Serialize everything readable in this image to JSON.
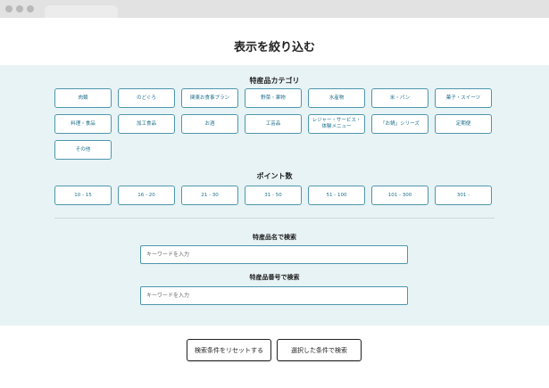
{
  "page": {
    "title": "表示を絞り込む"
  },
  "category_section": {
    "heading": "特産品カテゴリ",
    "items": [
      "肉類",
      "のどぐろ",
      "関東お食事プラン",
      "野菜・果物",
      "水産物",
      "米・パン",
      "菓子・スイーツ",
      "料理・食品",
      "加工食品",
      "お酒",
      "工芸品",
      "レジャー・サービス・体験メニュー",
      "「お鍋」シリーズ",
      "定期便",
      "その他"
    ]
  },
  "points_section": {
    "heading": "ポイント数",
    "items": [
      "10 - 15",
      "16 - 20",
      "21 - 30",
      "31 - 50",
      "51 - 100",
      "101 - 300",
      "301 -"
    ]
  },
  "name_search": {
    "label": "特産品名で検索",
    "placeholder": "キーワードを入力"
  },
  "number_search": {
    "label": "特産品番号で検索",
    "placeholder": "キーワードを入力"
  },
  "actions": {
    "reset_label": "検索条件をリセットする",
    "search_label": "選択した条件で検索"
  }
}
